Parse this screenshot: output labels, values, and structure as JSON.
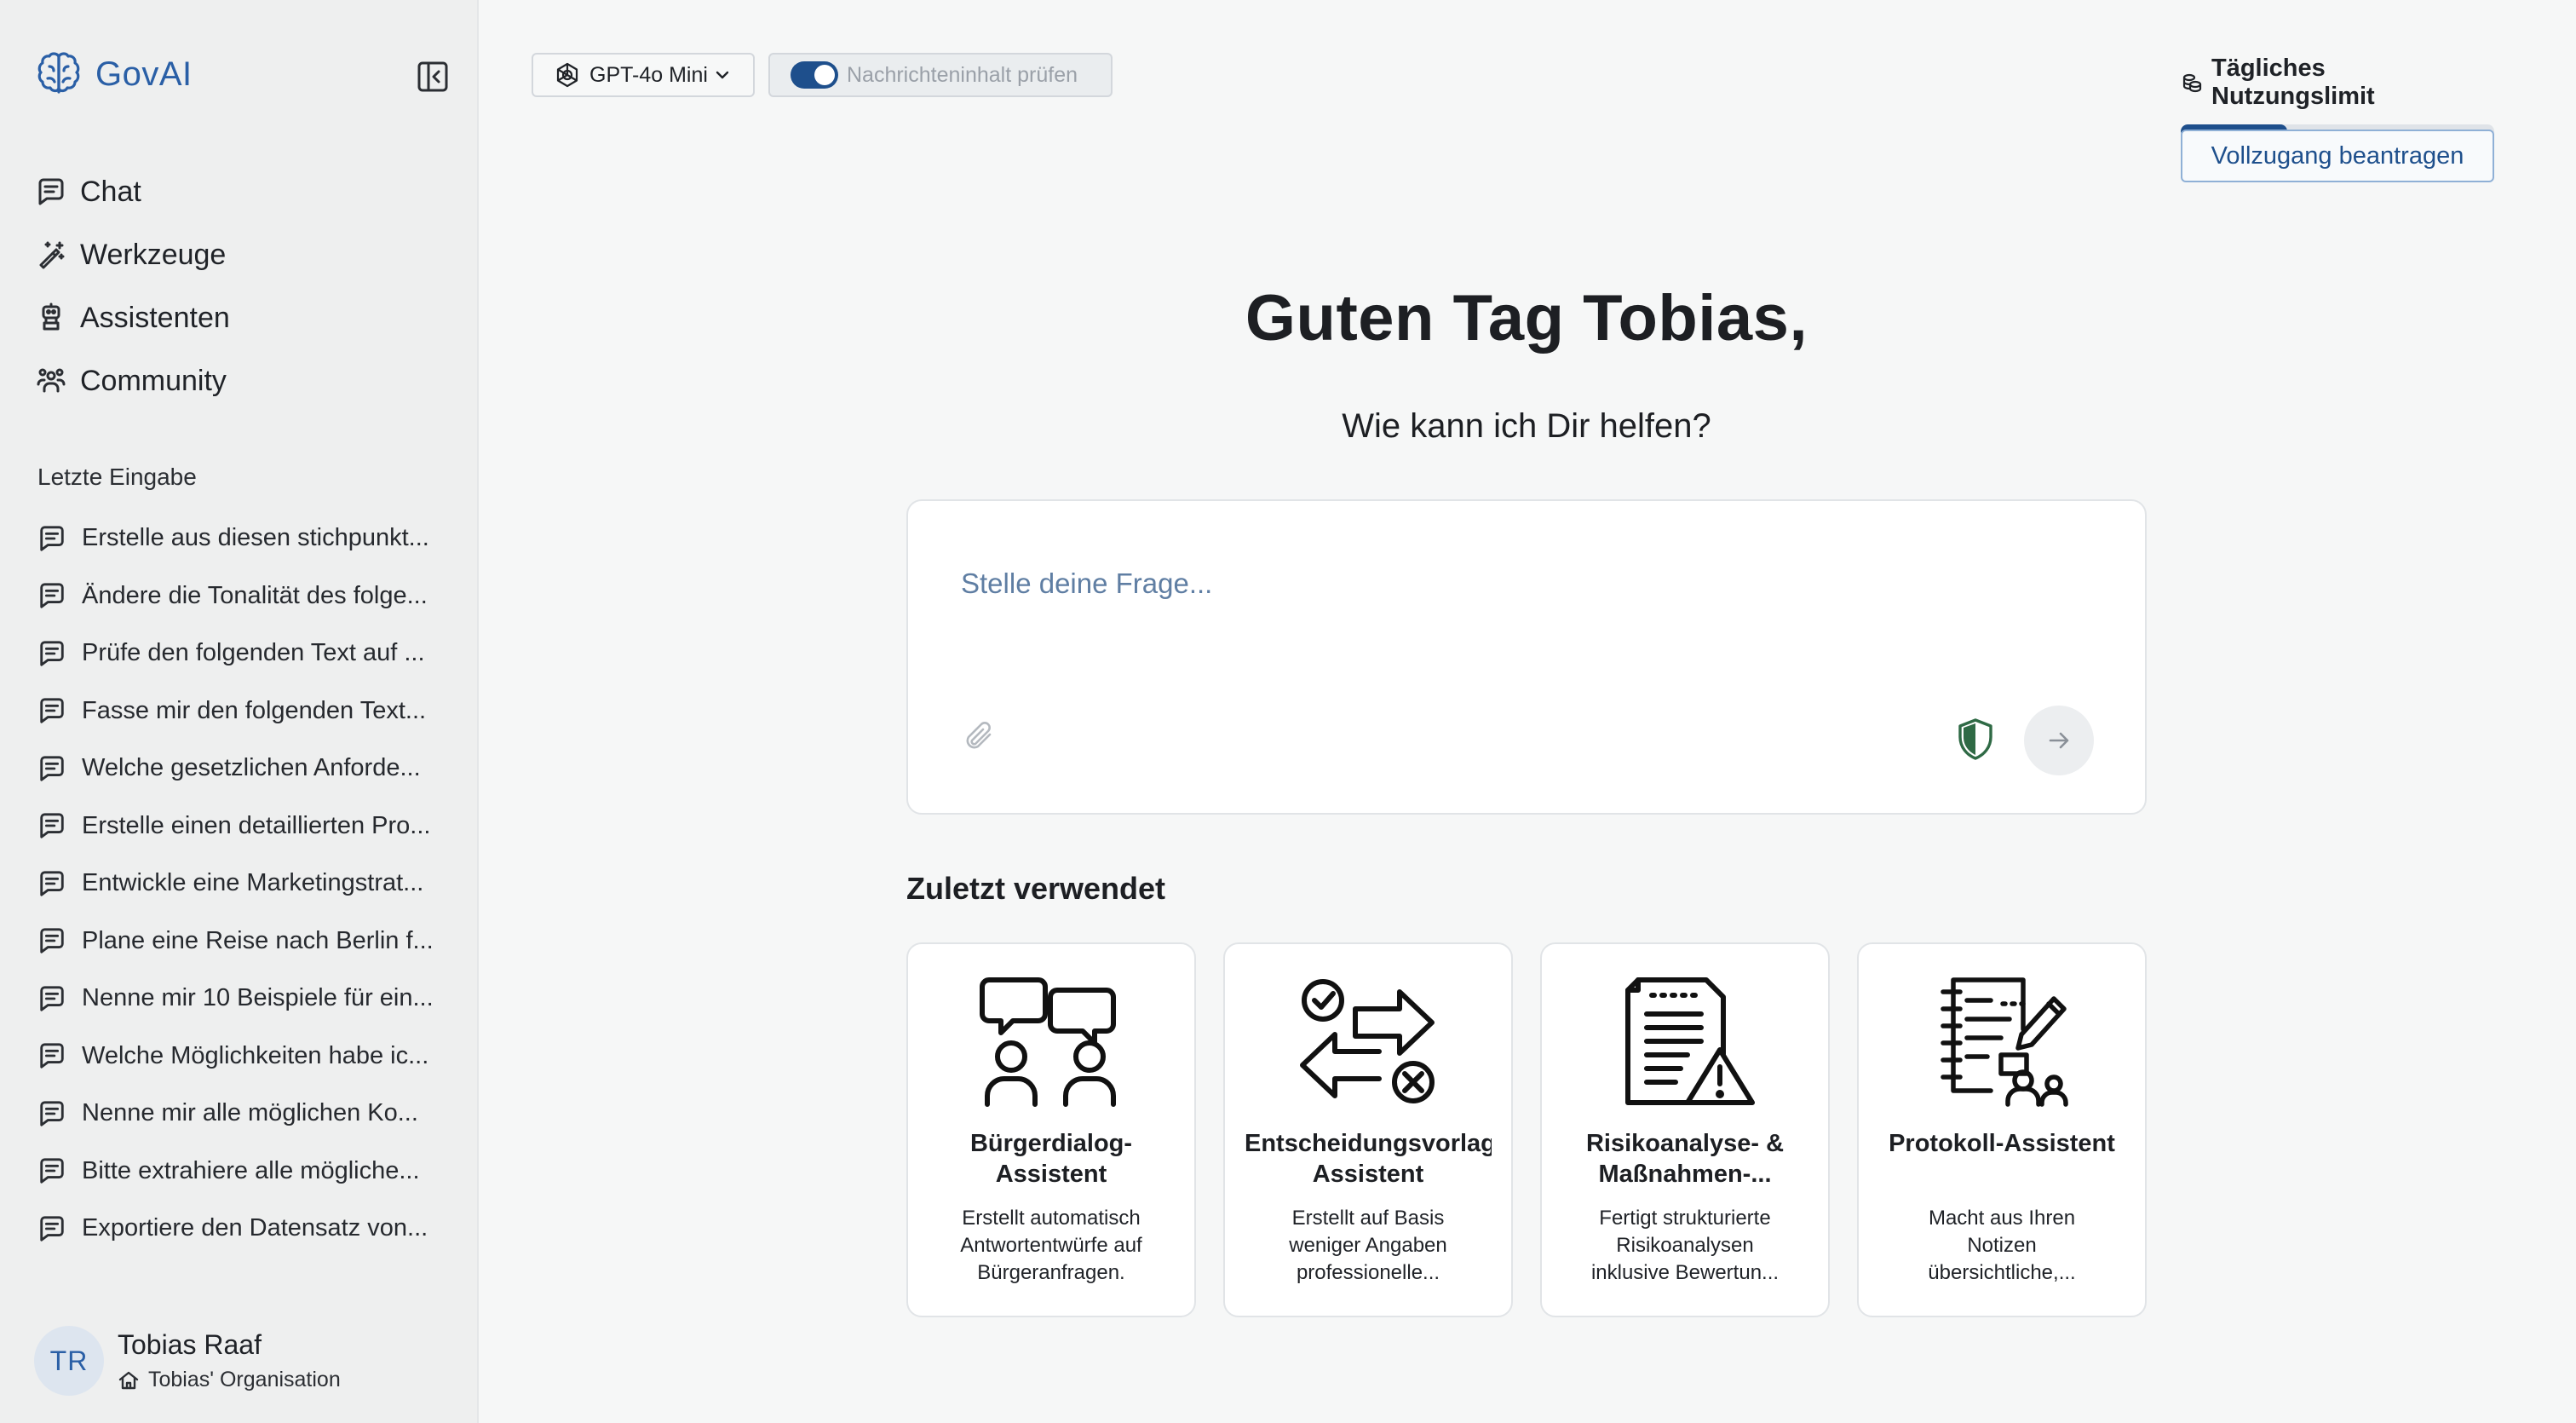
{
  "app": {
    "name": "GovAI"
  },
  "nav": [
    {
      "label": "Chat",
      "icon": "chat-icon"
    },
    {
      "label": "Werkzeuge",
      "icon": "wand-icon"
    },
    {
      "label": "Assistenten",
      "icon": "robot-icon"
    },
    {
      "label": "Community",
      "icon": "users-icon"
    }
  ],
  "recent": {
    "title": "Letzte Eingabe",
    "items": [
      "Erstelle aus diesen stichpunkt...",
      "Ändere die Tonalität des folge...",
      "Prüfe den folgenden Text auf ...",
      "Fasse mir den folgenden Text...",
      "Welche gesetzlichen Anforde...",
      "Erstelle einen detaillierten Pro...",
      "Entwickle eine Marketingstrat...",
      "Plane eine Reise nach Berlin f...",
      "Nenne mir 10 Beispiele für ein...",
      "Welche Möglichkeiten habe ic...",
      "Nenne mir alle möglichen Ko...",
      "Bitte extrahiere alle mögliche...",
      "Exportiere den Datensatz von..."
    ]
  },
  "user": {
    "initials": "TR",
    "name": "Tobias Raaf",
    "org": "Tobias' Organisation"
  },
  "topbar": {
    "model": "GPT-4o Mini",
    "toggle_label": "Nachrichteninhalt prüfen",
    "toggle_on": true
  },
  "limit": {
    "title": "Tägliches Nutzungslimit",
    "usage_fraction": 0.34,
    "button": "Vollzugang beantragen"
  },
  "main": {
    "greeting": "Guten Tag Tobias,",
    "subgreeting": "Wie kann ich Dir helfen?",
    "input_placeholder": "Stelle deine Frage..."
  },
  "recent_used": {
    "title": "Zuletzt verwendet",
    "cards": [
      {
        "title": "Bürgerdialog-Assistent",
        "desc": "Erstellt automatisch Antwortentwürfe auf Bürgeranfragen.",
        "icon": "dialog-people-icon"
      },
      {
        "title": "Entscheidungsvorlagen-Assistent",
        "desc": "Erstellt auf Basis weniger Angaben professionelle...",
        "icon": "decision-arrows-icon"
      },
      {
        "title": "Risikoanalyse- & Maßnahmen-...",
        "desc": "Fertigt strukturierte Risikoanalysen inklusive Bewertun...",
        "icon": "risk-document-icon"
      },
      {
        "title": "Protokoll-Assistent",
        "desc": "Macht aus Ihren Notizen übersichtliche,...",
        "icon": "protocol-notebook-icon"
      }
    ]
  },
  "colors": {
    "brand": "#2a5fa6",
    "accent": "#1e4f8c",
    "shield": "#2f6a45"
  }
}
